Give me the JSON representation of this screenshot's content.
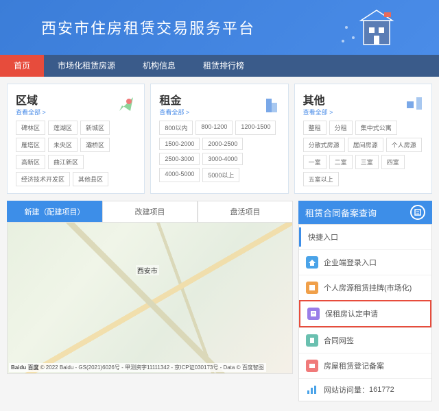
{
  "banner": {
    "title": "西安市住房租赁交易服务平台"
  },
  "nav": {
    "items": [
      "首页",
      "市场化租赁房源",
      "机构信息",
      "租赁排行榜"
    ],
    "active": 0
  },
  "filters": {
    "region": {
      "title": "区域",
      "view_all": "查看全部 >",
      "chips": [
        "碑林区",
        "莲湖区",
        "新城区",
        "雁塔区",
        "未央区",
        "灞桥区",
        "高新区",
        "曲江新区",
        "经济技术开发区",
        "其他县区"
      ]
    },
    "rent": {
      "title": "租金",
      "view_all": "查看全部 >",
      "chips": [
        "800以内",
        "800-1200",
        "1200-1500",
        "1500-2000",
        "2000-2500",
        "2500-3000",
        "3000-4000",
        "4000-5000",
        "5000以上"
      ]
    },
    "other": {
      "title": "其他",
      "view_all": "查看全部 >",
      "chips": [
        "整租",
        "分租",
        "集中式公寓",
        "分散式房源",
        "居间房源",
        "个人房源",
        "一室",
        "二室",
        "三室",
        "四室",
        "五室以上"
      ]
    }
  },
  "tabs": {
    "items": [
      "新建（配建项目）",
      "改建项目",
      "盘活项目"
    ],
    "active": 0
  },
  "map": {
    "city": "西安市",
    "attribution": "© 2022 Baidu - GS(2021)6026号 - 甲测资字11111342 - 京ICP证030173号 - Data © 百度智图",
    "logo": "Baidu 百度"
  },
  "search": {
    "title": "租赁合同备案查询"
  },
  "quick": {
    "title": "快捷入口",
    "items": [
      {
        "label": "企业端登录入口",
        "color": "#4aa3e8"
      },
      {
        "label": "个人房源租赁挂牌(市场化)",
        "color": "#f0a04a"
      },
      {
        "label": "保租房认定申请",
        "color": "#9a7ee8",
        "highlight": true
      },
      {
        "label": "合同网签",
        "color": "#6ac0b0"
      },
      {
        "label": "房屋租赁登记备案",
        "color": "#f07a7a"
      }
    ],
    "visit_label": "网站访问量：",
    "visit_count": "161772"
  }
}
